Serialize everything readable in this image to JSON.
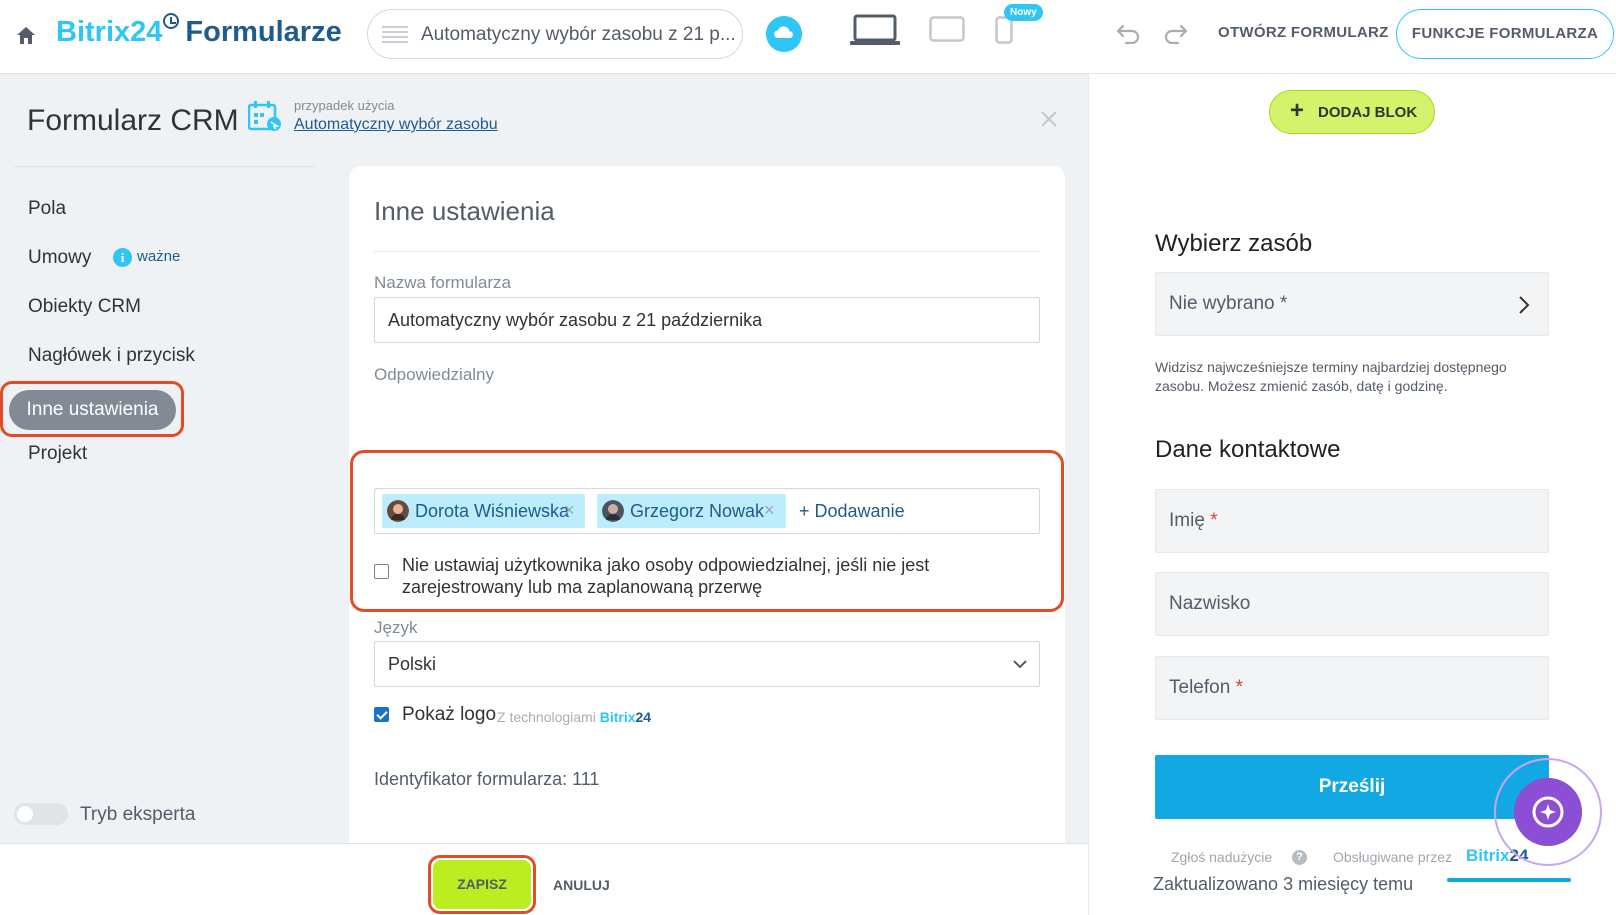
{
  "header": {
    "brand_prefix": "Bitrix24",
    "brand_suffix": "Formularze",
    "form_selector": "Automatyczny wybór zasobu z 21 p...",
    "new_badge": "Nowy",
    "open_form": "OTWÓRZ FORMULARZ",
    "form_features": "FUNKCJE FORMULARZA"
  },
  "sidebar": {
    "title": "Formularz CRM",
    "use_case_label": "przypadek użycia",
    "use_case_link": "Automatyczny wybór zasobu",
    "items": [
      {
        "label": "Pola"
      },
      {
        "label": "Umowy"
      },
      {
        "label": "Obiekty CRM"
      },
      {
        "label": "Nagłówek i przycisk"
      },
      {
        "label": "Inne ustawienia",
        "active": true
      },
      {
        "label": "Projekt"
      }
    ],
    "info_glyph": "i",
    "important_label": "ważne",
    "expert_mode": "Tryb eksperta"
  },
  "settings": {
    "title": "Inne ustawienia",
    "form_name_label": "Nazwa formularza",
    "form_name_value": "Automatyczny wybór zasobu z 21 października",
    "responsible_label": "Odpowiedzialny",
    "responsible_users": [
      {
        "name": "Dorota Wiśniewska"
      },
      {
        "name": "Grzegorz Nowak"
      }
    ],
    "remove_glyph": "×",
    "add_link": "+ Dodawanie",
    "checkbox_text": "Nie ustawiaj użytkownika jako osoby odpowiedzialnej, jeśli nie jest zarejestrowany lub ma zaplanowaną przerwę",
    "language_label": "Język",
    "language_value": "Polski",
    "show_logo": "Pokaż logo",
    "logo_credit_prefix": "Z technologiami",
    "logo_credit_brand": "Bitrix",
    "logo_credit_num": "24",
    "form_id_text": "Identyfikator formularza: 111"
  },
  "footer": {
    "save": "ZAPISZ",
    "cancel": "ANULUJ"
  },
  "preview": {
    "add_block_plus": "+",
    "add_block": "DODAJ BLOK",
    "resource_heading": "Wybierz zasób",
    "resource_placeholder": "Nie wybrano *",
    "resource_note": "Widzisz najwcześniejsze terminy najbardziej dostępnego zasobu. Możesz zmienić zasób, datę i godzinę.",
    "contact_heading": "Dane kontaktowe",
    "fields": [
      {
        "label": "Imię",
        "required_mark": "*"
      },
      {
        "label": "Nazwisko",
        "required_mark": ""
      },
      {
        "label": "Telefon",
        "required_mark": "*"
      }
    ],
    "submit": "Prześlij",
    "report_abuse": "Zgłoś nadużycie",
    "help_glyph": "?",
    "powered_by": "Obsługiwane przez",
    "powered_brand": "Bitrix",
    "powered_num": "24",
    "updated": "Zaktualizowano 3 miesięcy temu"
  },
  "colors": {
    "accent_blue": "#2fc6f6",
    "brand_dark": "#1f5b8c",
    "highlight_red": "#e24d26",
    "save_green": "#bbed21",
    "submit_blue": "#12a8e4",
    "assistant_purple": "#8d4ed6"
  }
}
